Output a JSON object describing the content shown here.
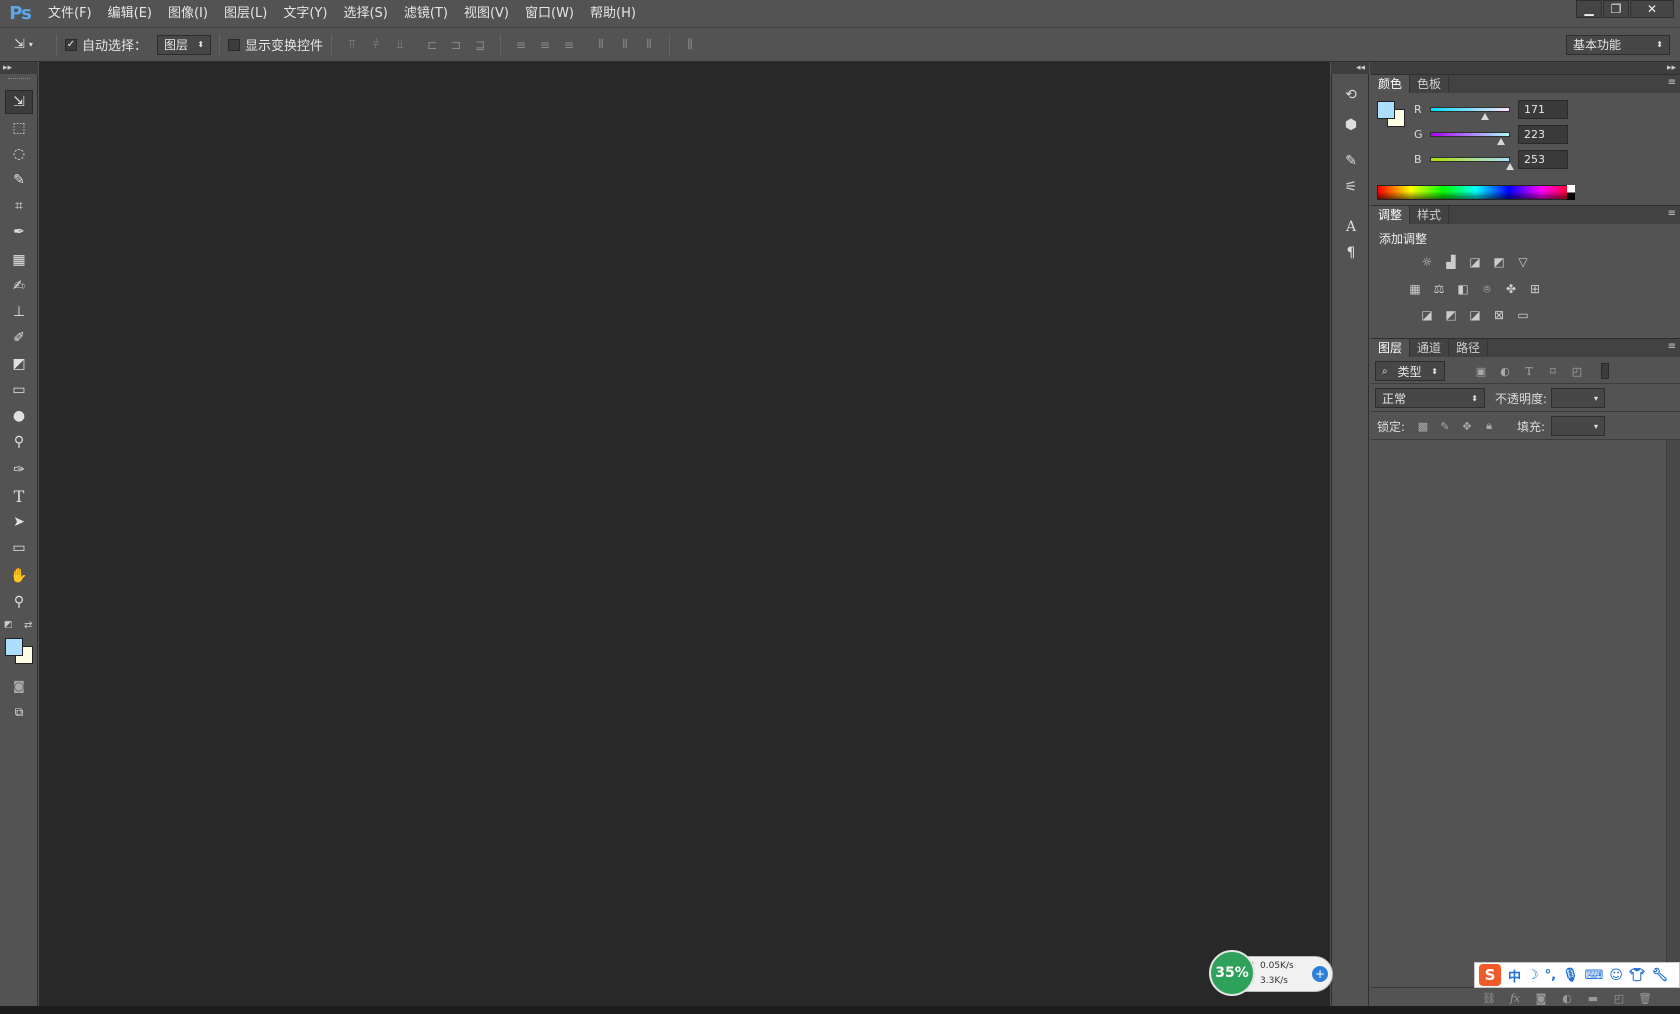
{
  "app": {
    "logo": "Ps"
  },
  "menu": [
    "文件(F)",
    "编辑(E)",
    "图像(I)",
    "图层(L)",
    "文字(Y)",
    "选择(S)",
    "滤镜(T)",
    "视图(V)",
    "窗口(W)",
    "帮助(H)"
  ],
  "window_controls": {
    "minimize": "▁",
    "restore": "❐",
    "close": "✕"
  },
  "options": {
    "auto_select_label": "自动选择：",
    "auto_select_checked": "✓",
    "auto_select_target": "图层",
    "show_transform_label": "显示变换控件",
    "workspace": "基本功能"
  },
  "tools": [
    {
      "name": "move-tool",
      "glyph": "⇲"
    },
    {
      "name": "marquee-tool",
      "glyph": "⬚"
    },
    {
      "name": "lasso-tool",
      "glyph": "◌"
    },
    {
      "name": "quick-select-tool",
      "glyph": "✎"
    },
    {
      "name": "crop-tool",
      "glyph": "⌗"
    },
    {
      "name": "eyedropper-tool",
      "glyph": "✒"
    },
    {
      "name": "healing-brush-tool",
      "glyph": "▦"
    },
    {
      "name": "brush-tool",
      "glyph": "✍"
    },
    {
      "name": "stamp-tool",
      "glyph": "⊥"
    },
    {
      "name": "history-brush-tool",
      "glyph": "✐"
    },
    {
      "name": "eraser-tool",
      "glyph": "◩"
    },
    {
      "name": "gradient-tool",
      "glyph": "▭"
    },
    {
      "name": "blur-tool",
      "glyph": "●"
    },
    {
      "name": "dodge-tool",
      "glyph": "⚲"
    },
    {
      "name": "pen-tool",
      "glyph": "✑"
    },
    {
      "name": "type-tool",
      "glyph": "T"
    },
    {
      "name": "path-select-tool",
      "glyph": "➤"
    },
    {
      "name": "shape-tool",
      "glyph": "▭"
    },
    {
      "name": "hand-tool",
      "glyph": "✋"
    },
    {
      "name": "zoom-tool",
      "glyph": "⚲"
    }
  ],
  "colors": {
    "foreground": "#abdffd",
    "background": "#fffde6"
  },
  "color_panel": {
    "tabs": [
      "颜色",
      "色板"
    ],
    "R": {
      "label": "R",
      "value": "171",
      "fraction": 0.67
    },
    "G": {
      "label": "G",
      "value": "223",
      "fraction": 0.87
    },
    "B": {
      "label": "B",
      "value": "253",
      "fraction": 0.99
    }
  },
  "adjust_panel": {
    "tabs": [
      "调整",
      "样式"
    ],
    "title": "添加调整",
    "icons": [
      "brightness-icon",
      "levels-icon",
      "curves-icon",
      "exposure-icon",
      "vibrance-icon",
      "hue-sat-icon",
      "color-balance-icon",
      "bw-icon",
      "photo-filter-icon",
      "channel-mixer-icon",
      "color-lookup-icon",
      "invert-icon",
      "posterize-icon",
      "threshold-icon",
      "selective-color-icon",
      "gradient-map-icon"
    ]
  },
  "layers_panel": {
    "tabs": [
      "图层",
      "通道",
      "路径"
    ],
    "filter_kind": "类型",
    "blend_mode": "正常",
    "opacity_label": "不透明度:",
    "lock_label": "锁定:",
    "fill_label": "填充:"
  },
  "net_widget": {
    "percent": "35%",
    "up": "0.05K/s",
    "down": "3.3K/s"
  },
  "ime": {
    "logo": "S",
    "lang": "中"
  }
}
